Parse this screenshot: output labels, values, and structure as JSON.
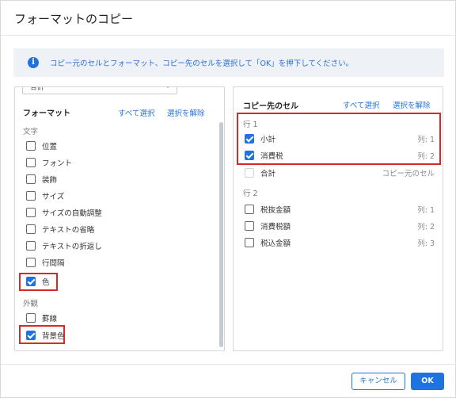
{
  "dialog": {
    "title": "フォーマットのコピー",
    "info_text": "コピー元のセルとフォーマット、コピー先のセルを選択して「OK」を押下してください。",
    "info_icon": "info-icon"
  },
  "left": {
    "dropdown_value": "合計",
    "heading": "フォーマット",
    "select_all": "すべて選択",
    "deselect": "選択を解除",
    "groups": [
      {
        "label": "文字",
        "items": [
          {
            "label": "位置",
            "checked": false
          },
          {
            "label": "フォント",
            "checked": false
          },
          {
            "label": "装飾",
            "checked": false
          },
          {
            "label": "サイズ",
            "checked": false
          },
          {
            "label": "サイズの自動調整",
            "checked": false
          },
          {
            "label": "テキストの省略",
            "checked": false
          },
          {
            "label": "テキストの折返し",
            "checked": false
          },
          {
            "label": "行間隔",
            "checked": false
          },
          {
            "label": "色",
            "checked": true
          }
        ]
      },
      {
        "label": "外観",
        "items": [
          {
            "label": "罫線",
            "checked": false
          },
          {
            "label": "背景色",
            "checked": true
          }
        ]
      }
    ]
  },
  "right": {
    "heading": "コピー先のセル",
    "select_all": "すべて選択",
    "deselect": "選択を解除",
    "groups": [
      {
        "label": "行 1",
        "items": [
          {
            "label": "小計",
            "right": "列: 1",
            "checked": true
          },
          {
            "label": "消費税",
            "right": "列: 2",
            "checked": true
          },
          {
            "label": "合計",
            "right": "コピー元のセル",
            "checked": false,
            "disabled": true
          }
        ]
      },
      {
        "label": "行 2",
        "items": [
          {
            "label": "税抜金額",
            "right": "列: 1",
            "checked": false
          },
          {
            "label": "消費税額",
            "right": "列: 2",
            "checked": false
          },
          {
            "label": "税込金額",
            "right": "列: 3",
            "checked": false
          }
        ]
      }
    ]
  },
  "footer": {
    "cancel": "キャンセル",
    "ok": "OK"
  },
  "colors": {
    "accent": "#1f73e0",
    "highlight_box": "#d62a2a"
  }
}
